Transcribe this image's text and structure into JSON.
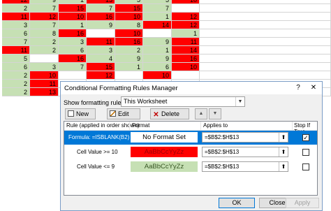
{
  "colors": {
    "red": "#ff0000",
    "green": "#c6e0b4",
    "accent": "#0078d7"
  },
  "sheet": {
    "rows": [
      [
        {
          "v": "12",
          "f": "r"
        },
        {
          "v": "9",
          "f": "g"
        },
        {
          "v": "1",
          "f": "g"
        },
        {
          "v": "15",
          "f": "r"
        },
        {
          "v": "5",
          "f": "g"
        },
        {
          "v": "5",
          "f": "g"
        },
        {
          "v": "10",
          "f": "r"
        }
      ],
      [
        {
          "v": "2",
          "f": "g"
        },
        {
          "v": "7",
          "f": "g"
        },
        {
          "v": "15",
          "f": "r"
        },
        {
          "v": "7",
          "f": "g"
        },
        {
          "v": "15",
          "f": "r"
        },
        {
          "v": "7",
          "f": "g"
        },
        {
          "v": "",
          "f": "w"
        }
      ],
      [
        {
          "v": "11",
          "f": "r"
        },
        {
          "v": "12",
          "f": "r"
        },
        {
          "v": "10",
          "f": "r"
        },
        {
          "v": "16",
          "f": "r"
        },
        {
          "v": "10",
          "f": "r"
        },
        {
          "v": "1",
          "f": "g"
        },
        {
          "v": "12",
          "f": "r"
        }
      ],
      [
        {
          "v": "3",
          "f": "g"
        },
        {
          "v": "7",
          "f": "g"
        },
        {
          "v": "1",
          "f": "g"
        },
        {
          "v": "9",
          "f": "g"
        },
        {
          "v": "8",
          "f": "g"
        },
        {
          "v": "14",
          "f": "r"
        },
        {
          "v": "12",
          "f": "r"
        }
      ],
      [
        {
          "v": "6",
          "f": "g"
        },
        {
          "v": "8",
          "f": "g"
        },
        {
          "v": "16",
          "f": "r"
        },
        {
          "v": "",
          "f": "w"
        },
        {
          "v": "10",
          "f": "r"
        },
        {
          "v": "",
          "f": "w"
        },
        {
          "v": "1",
          "f": "g"
        }
      ],
      [
        {
          "v": "7",
          "f": "g"
        },
        {
          "v": "2",
          "f": "g"
        },
        {
          "v": "3",
          "f": "g"
        },
        {
          "v": "11",
          "f": "r"
        },
        {
          "v": "16",
          "f": "r"
        },
        {
          "v": "9",
          "f": "g"
        },
        {
          "v": "11",
          "f": "r"
        }
      ],
      [
        {
          "v": "11",
          "f": "r"
        },
        {
          "v": "2",
          "f": "g"
        },
        {
          "v": "6",
          "f": "g"
        },
        {
          "v": "3",
          "f": "g"
        },
        {
          "v": "2",
          "f": "g"
        },
        {
          "v": "1",
          "f": "g"
        },
        {
          "v": "14",
          "f": "r"
        }
      ],
      [
        {
          "v": "5",
          "f": "g"
        },
        {
          "v": "",
          "f": "w"
        },
        {
          "v": "16",
          "f": "r"
        },
        {
          "v": "4",
          "f": "g"
        },
        {
          "v": "9",
          "f": "g"
        },
        {
          "v": "9",
          "f": "g"
        },
        {
          "v": "16",
          "f": "r"
        }
      ],
      [
        {
          "v": "6",
          "f": "g"
        },
        {
          "v": "3",
          "f": "g"
        },
        {
          "v": "7",
          "f": "g"
        },
        {
          "v": "15",
          "f": "r"
        },
        {
          "v": "1",
          "f": "g"
        },
        {
          "v": "6",
          "f": "g"
        },
        {
          "v": "10",
          "f": "r"
        }
      ],
      [
        {
          "v": "2",
          "f": "g"
        },
        {
          "v": "10",
          "f": "r"
        },
        {
          "v": "",
          "f": "w"
        },
        {
          "v": "12",
          "f": "r"
        },
        {
          "v": "",
          "f": "w"
        },
        {
          "v": "10",
          "f": "r"
        },
        {
          "v": "",
          "f": "w"
        }
      ],
      [
        {
          "v": "2",
          "f": "g"
        },
        {
          "v": "11",
          "f": "r"
        },
        {
          "v": "",
          "f": "w"
        },
        {
          "v": "",
          "f": "w"
        },
        {
          "v": "",
          "f": "w"
        },
        {
          "v": "",
          "f": "w"
        },
        {
          "v": "",
          "f": "w"
        }
      ],
      [
        {
          "v": "2",
          "f": "g"
        },
        {
          "v": "13",
          "f": "r"
        },
        {
          "v": "",
          "f": "w"
        },
        {
          "v": "",
          "f": "w"
        },
        {
          "v": "",
          "f": "w"
        },
        {
          "v": "",
          "f": "w"
        },
        {
          "v": "",
          "f": "w"
        }
      ]
    ]
  },
  "dialog": {
    "title": "Conditional Formatting Rules Manager",
    "help": "?",
    "close": "✕",
    "show_label": "Show formatting rules for:",
    "show_value": "This Worksheet",
    "toolbar": {
      "new_rule": "New Rule...",
      "edit_rule": "Edit Rule...",
      "delete_rule": "Delete Rule"
    },
    "headers": {
      "rule": "Rule (applied in order shown)",
      "format": "Format",
      "applies": "Applies to",
      "stop": "Stop If True"
    },
    "rules": [
      {
        "rule": "Formula: =ISBLANK(B2)",
        "format": "No Format Set",
        "applies": "=$B$2:$H$13",
        "stop": true,
        "fill": "#ffffff",
        "text": "#000000"
      },
      {
        "rule": "Cell Value >= 10",
        "format": "AaBbCcYyZz",
        "applies": "=$B$2:$H$13",
        "stop": false,
        "fill": "#ff0000",
        "text": "#9c0006"
      },
      {
        "rule": "Cell Value <= 9",
        "format": "AaBbCcYyZz",
        "applies": "=$B$2:$H$13",
        "stop": false,
        "fill": "#c6e0b4",
        "text": "#375623"
      }
    ],
    "buttons": {
      "ok": "OK",
      "close": "Close",
      "apply": "Apply"
    }
  }
}
